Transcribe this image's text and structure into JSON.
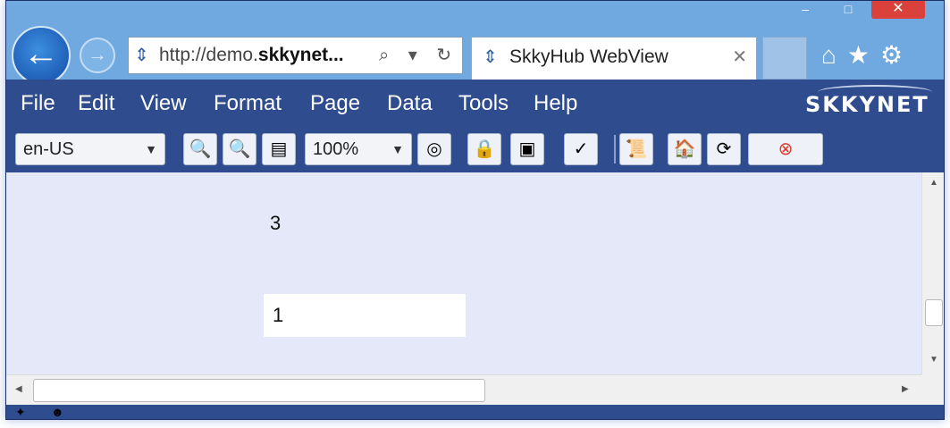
{
  "window": {
    "caption": {
      "minimize": "–",
      "maximize": "□",
      "close": "✕"
    }
  },
  "nav": {
    "back_glyph": "←",
    "forward_glyph": "→",
    "url_prefix": "http://demo.",
    "url_bold": "skkynet...",
    "url_tools": "⌕ ▾ ↻",
    "site_icon": "ie-page-icon"
  },
  "tab": {
    "title": "SkkyHub WebView",
    "close": "✕"
  },
  "right_icons": {
    "home": "⌂",
    "favorites": "★",
    "settings": "⚙"
  },
  "menu": {
    "items": [
      "File",
      "Edit",
      "View",
      "Format",
      "Page",
      "Data",
      "Tools",
      "Help"
    ]
  },
  "logo": {
    "text": "SKKYNET"
  },
  "toolbar": {
    "locale_select": {
      "value": "en-US",
      "arrow": "▼"
    },
    "zoom_select": {
      "value": "100%",
      "arrow": "▼"
    },
    "buttons": [
      {
        "name": "zoom-in-icon",
        "glyph": "🔍"
      },
      {
        "name": "zoom-out-icon",
        "glyph": "🔍"
      },
      {
        "name": "fit-page-icon",
        "glyph": "▤"
      },
      {
        "name": "target-icon",
        "glyph": "◎"
      },
      {
        "name": "lock-icon",
        "glyph": "🔒"
      },
      {
        "name": "frame-icon",
        "glyph": "▣"
      },
      {
        "name": "checklist-icon",
        "glyph": "✓"
      },
      {
        "name": "scroll-document-icon",
        "glyph": "📜"
      },
      {
        "name": "home-icon",
        "glyph": "🏠"
      },
      {
        "name": "refresh-icon",
        "glyph": "⟳"
      },
      {
        "name": "stop-icon",
        "glyph": "⊗"
      }
    ]
  },
  "content": {
    "label_value": "3",
    "input_value": "1"
  },
  "scroll": {
    "up": "▲",
    "down": "▼",
    "left": "◀",
    "right": "▶"
  }
}
